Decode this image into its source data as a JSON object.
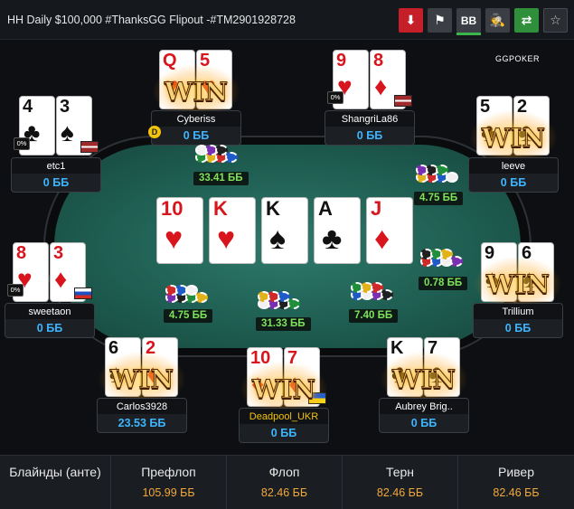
{
  "header": {
    "title": "HH Daily $100,000 #ThanksGG Flipout -#TM2901928728",
    "buttons": [
      {
        "name": "download-icon",
        "label": "⬇"
      },
      {
        "name": "flag-icon",
        "label": "⚑"
      },
      {
        "name": "bb-button",
        "label": "BB"
      },
      {
        "name": "spy-icon",
        "label": "🕵"
      },
      {
        "name": "share-icon",
        "label": "⇄"
      },
      {
        "name": "star-icon",
        "label": "☆"
      }
    ]
  },
  "logo": {
    "main": "GG",
    "sub": "POKER"
  },
  "board": [
    {
      "rank": "10",
      "suit": "♥",
      "color": "red"
    },
    {
      "rank": "K",
      "suit": "♥",
      "color": "red"
    },
    {
      "rank": "K",
      "suit": "♠",
      "color": "black"
    },
    {
      "rank": "A",
      "suit": "♣",
      "color": "black"
    },
    {
      "rank": "J",
      "suit": "♦",
      "color": "red"
    }
  ],
  "players": [
    {
      "name": "etc1",
      "stack": "0 ББ",
      "pct": "0%",
      "flag": "lv",
      "win": false,
      "dealer": false,
      "cards": [
        {
          "rank": "4",
          "suit": "♣",
          "color": "black"
        },
        {
          "rank": "3",
          "suit": "♠",
          "color": "black"
        }
      ]
    },
    {
      "name": "Cyberiss",
      "stack": "0 ББ",
      "pct": "",
      "flag": "",
      "win": true,
      "dealer": true,
      "cards": [
        {
          "rank": "Q",
          "suit": "♥",
          "color": "red"
        },
        {
          "rank": "5",
          "suit": "♥",
          "color": "red"
        }
      ]
    },
    {
      "name": "ShangriLa86",
      "stack": "0 ББ",
      "pct": "0%",
      "flag": "lv",
      "win": false,
      "dealer": false,
      "cards": [
        {
          "rank": "9",
          "suit": "♥",
          "color": "red"
        },
        {
          "rank": "8",
          "suit": "♦",
          "color": "red"
        }
      ]
    },
    {
      "name": "leeve",
      "stack": "0 ББ",
      "pct": "",
      "flag": "",
      "win": true,
      "dealer": false,
      "cards": [
        {
          "rank": "5",
          "suit": "♣",
          "color": "black"
        },
        {
          "rank": "2",
          "suit": "♣",
          "color": "black"
        }
      ]
    },
    {
      "name": "Trillium",
      "stack": "0 ББ",
      "pct": "",
      "flag": "",
      "win": true,
      "dealer": false,
      "cards": [
        {
          "rank": "9",
          "suit": "♠",
          "color": "black"
        },
        {
          "rank": "6",
          "suit": "♠",
          "color": "black"
        }
      ]
    },
    {
      "name": "Aubrey Brig..",
      "stack": "0 ББ",
      "pct": "",
      "flag": "",
      "win": true,
      "dealer": false,
      "cards": [
        {
          "rank": "K",
          "suit": "♣",
          "color": "black"
        },
        {
          "rank": "7",
          "suit": "♣",
          "color": "black"
        }
      ]
    },
    {
      "name": "Deadpool_UKR",
      "stack": "0 ББ",
      "pct": "",
      "flag": "ua",
      "win": true,
      "dealer": false,
      "cards": [
        {
          "rank": "10",
          "suit": "♦",
          "color": "red"
        },
        {
          "rank": "7",
          "suit": "♦",
          "color": "red"
        }
      ]
    },
    {
      "name": "Carlos3928",
      "stack": "23.53 ББ",
      "pct": "",
      "flag": "",
      "win": true,
      "dealer": false,
      "cards": [
        {
          "rank": "6",
          "suit": "♠",
          "color": "black"
        },
        {
          "rank": "2",
          "suit": "♦",
          "color": "red"
        }
      ]
    },
    {
      "name": "sweetaon",
      "stack": "0 ББ",
      "pct": "0%",
      "flag": "ru",
      "win": false,
      "dealer": false,
      "cards": [
        {
          "rank": "8",
          "suit": "♥",
          "color": "red"
        },
        {
          "rank": "3",
          "suit": "♦",
          "color": "red"
        }
      ]
    }
  ],
  "win_text": "WIN",
  "pots": [
    "33.41 ББ",
    "4.75 ББ",
    "0.78 ББ",
    "7.40 ББ",
    "31.33 ББ",
    "4.75 ББ"
  ],
  "footer": {
    "columns": [
      {
        "head": "Блайнды (анте)",
        "value": ""
      },
      {
        "head": "Префлоп",
        "value": "105.99 ББ"
      },
      {
        "head": "Флоп",
        "value": "82.46 ББ"
      },
      {
        "head": "Терн",
        "value": "82.46 ББ"
      },
      {
        "head": "Ривер",
        "value": "82.46 ББ"
      }
    ]
  }
}
